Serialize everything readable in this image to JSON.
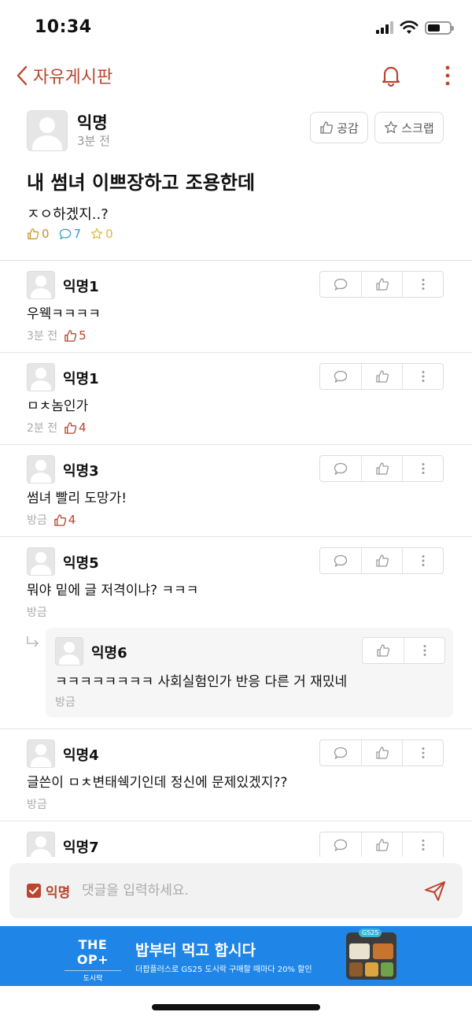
{
  "status_bar": {
    "time": "10:34"
  },
  "nav": {
    "title": "자유게시판",
    "back_icon": "chevron-left-icon",
    "bell_icon": "bell-icon",
    "more_icon": "vertical-dots-icon"
  },
  "post": {
    "author": "익명",
    "time": "3분 전",
    "like_button": "공감",
    "scrap_button": "스크랩",
    "title": "내 썸녀 이쁘장하고 조용한데",
    "body": "ㅈㅇ하겠지..?",
    "stats": {
      "likes": "0",
      "comments": "7",
      "scraps": "0"
    }
  },
  "comments": [
    {
      "author": "익명1",
      "text": "우웩ㅋㅋㅋㅋ",
      "time": "3분 전",
      "likes": "5"
    },
    {
      "author": "익명1",
      "text": "ㅁㅊ놈인가",
      "time": "2분 전",
      "likes": "4"
    },
    {
      "author": "익명3",
      "text": "썸녀 빨리 도망가!",
      "time": "방금",
      "likes": "4"
    },
    {
      "author": "익명5",
      "text": "뭐야 밑에 글 저격이냐? ㅋㅋㅋ",
      "time": "방금",
      "likes": ""
    },
    {
      "author": "익명4",
      "text": "글쓴이 ㅁㅊ변태쉑기인데 정신에 문제있겠지??",
      "time": "방금",
      "likes": ""
    },
    {
      "author": "익명7",
      "text": "",
      "time": "",
      "likes": ""
    }
  ],
  "reply": {
    "author": "익명6",
    "text": "ㅋㅋㅋㅋㅋㅋㅋㅋ 사회실험인가 반응 다른 거 재밌네",
    "time": "방금"
  },
  "input": {
    "anon_label": "익명",
    "placeholder": "댓글을 입력하세요.",
    "value": ""
  },
  "ad": {
    "logo_text": "THE OP+",
    "logo_sub": "도시락",
    "headline": "밥부터 먹고 합시다",
    "subtext": "더팝플러스로 GS25 도시락 구매할 때마다 20% 할인",
    "badge": "GS25"
  },
  "colors": {
    "accent": "#b9462f",
    "ad_bg": "#1f86e8",
    "likes_stat": "#c8912a",
    "comments_stat": "#2aa1c8",
    "scraps_stat": "#e0b83a"
  }
}
